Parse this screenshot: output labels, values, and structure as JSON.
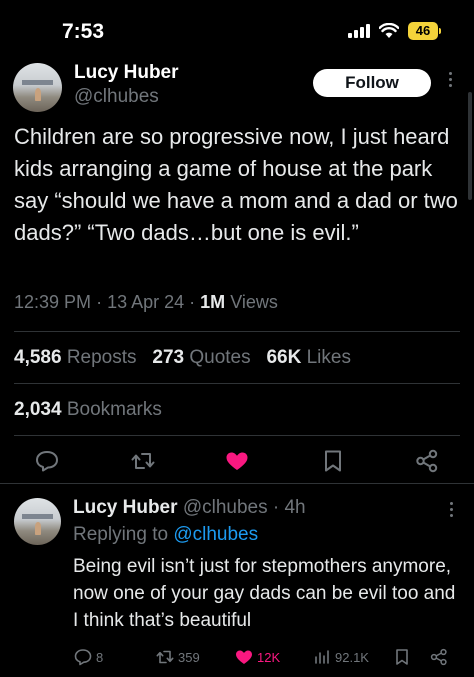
{
  "status_bar": {
    "time": "7:53",
    "battery": "46",
    "icons": [
      "signal-icon",
      "wifi-icon",
      "battery-icon"
    ]
  },
  "tweet": {
    "author_name": "Lucy Huber",
    "author_handle": "@clhubes",
    "follow_label": "Follow",
    "text": "Children are so progressive now, I just heard kids arranging a game of house at the park say “should we have a mom and a dad or two dads?” “Two dads…but one is evil.”",
    "time": "12:39 PM",
    "date": "13 Apr 24",
    "sep": "·",
    "views_count": "1M",
    "views_label": "Views",
    "reposts_count": "4,586",
    "reposts_label": "Reposts",
    "quotes_count": "273",
    "quotes_label": "Quotes",
    "likes_count": "66K",
    "likes_label": "Likes",
    "bookmarks_count": "2,034",
    "bookmarks_label": "Bookmarks",
    "liked_color": "#f91880",
    "actions": [
      "reply-icon",
      "repost-icon",
      "like-icon",
      "bookmark-icon",
      "share-icon"
    ]
  },
  "reply": {
    "author_name": "Lucy Huber",
    "author_handle": "@clhubes",
    "sep": "·",
    "age": "4h",
    "replying_prefix": "Replying to",
    "replying_handle": "@clhubes",
    "text": "Being evil isn’t just for stepmothers anymore, now one of your gay dads can be evil too and I think that’s beautiful",
    "reply_count": "8",
    "repost_count": "359",
    "like_count": "12K",
    "view_count": "92.1K"
  }
}
